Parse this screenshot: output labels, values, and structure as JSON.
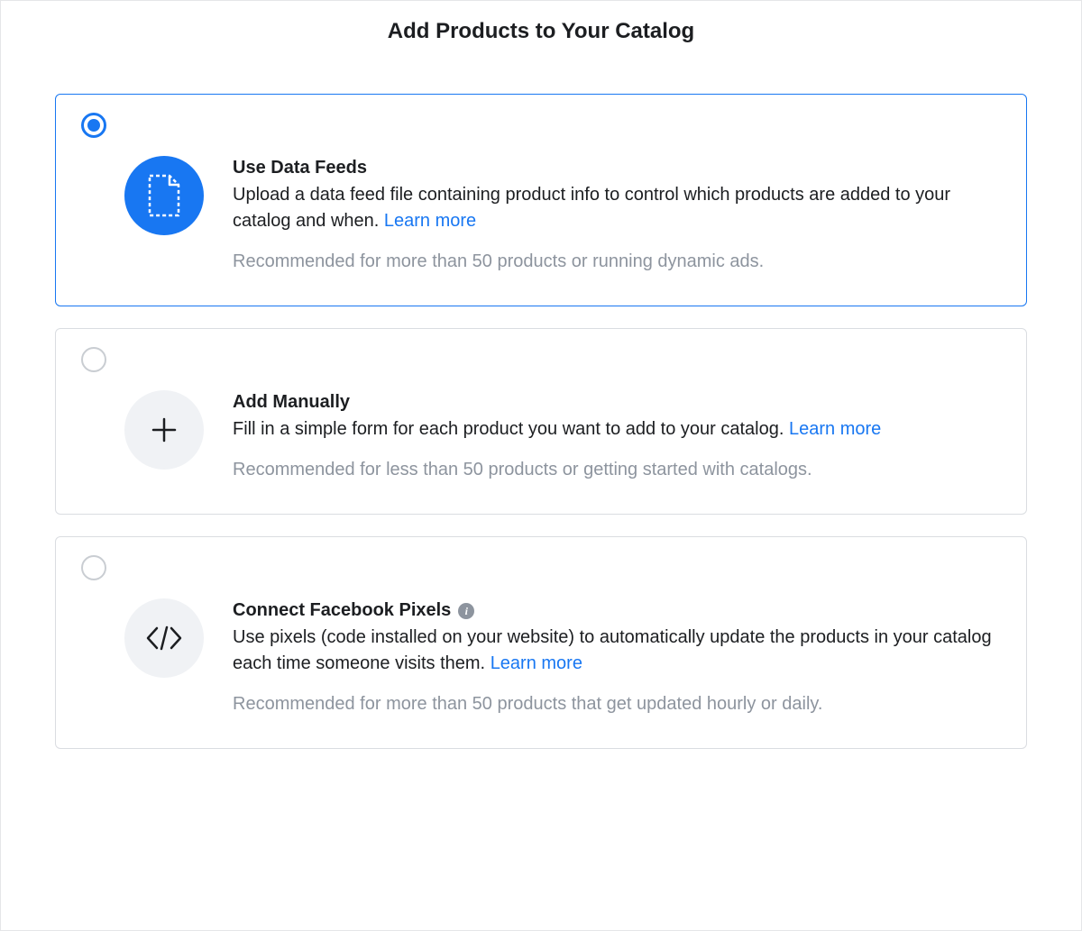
{
  "page_title": "Add Products to Your Catalog",
  "options": [
    {
      "id": "data-feeds",
      "selected": true,
      "title": "Use Data Feeds",
      "description": "Upload a data feed file containing product info to control which products are added to your catalog and when. ",
      "learn_more": "Learn more",
      "recommendation": "Recommended for more than 50 products or running dynamic ads.",
      "has_info_icon": false
    },
    {
      "id": "add-manually",
      "selected": false,
      "title": "Add Manually",
      "description": "Fill in a simple form for each product you want to add to your catalog. ",
      "learn_more": "Learn more",
      "recommendation": "Recommended for less than 50 products or getting started with catalogs.",
      "has_info_icon": false
    },
    {
      "id": "connect-pixels",
      "selected": false,
      "title": "Connect Facebook Pixels",
      "description": "Use pixels (code installed on your website) to automatically update the products in your catalog each time someone visits them. ",
      "learn_more": "Learn more",
      "recommendation": "Recommended for more than 50 products that get updated hourly or daily.",
      "has_info_icon": true
    }
  ]
}
